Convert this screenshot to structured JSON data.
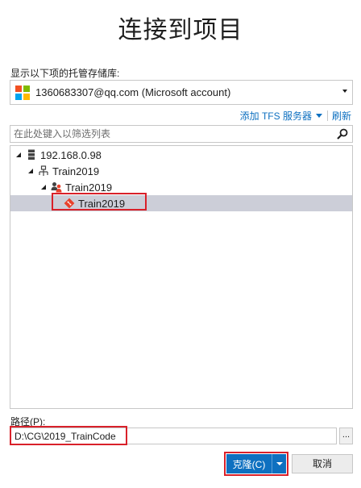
{
  "dialog": {
    "title": "连接到项目"
  },
  "repositories": {
    "label": "显示以下项的托管存储库:",
    "selected_account": "1360683307@qq.com (Microsoft account)",
    "logo_colors": [
      "#f25022",
      "#7fba00",
      "#00a4ef",
      "#ffb900"
    ],
    "add_server_link": "添加 TFS 服务器",
    "refresh_link": "刷新"
  },
  "filter": {
    "placeholder": "在此处键入以筛选列表",
    "icon": "search-icon"
  },
  "tree": {
    "nodes": [
      {
        "label": "192.168.0.98",
        "icon": "server-icon",
        "expanded": true
      },
      {
        "label": "Train2019",
        "icon": "collection-icon",
        "expanded": true
      },
      {
        "label": "Train2019",
        "icon": "team-project-icon",
        "expanded": true
      },
      {
        "label": "Train2019",
        "icon": "git-repo-icon",
        "selected": true
      }
    ]
  },
  "path": {
    "label": "路径(P):",
    "value": "D:\\CG\\2019_TrainCode",
    "browse_label": "..."
  },
  "buttons": {
    "clone": "克隆(C)",
    "cancel": "取消"
  },
  "colors": {
    "accent": "#0e70c0",
    "highlight_border": "#d9212a",
    "selection": "#ccced8",
    "git_icon": "#e8412c"
  }
}
